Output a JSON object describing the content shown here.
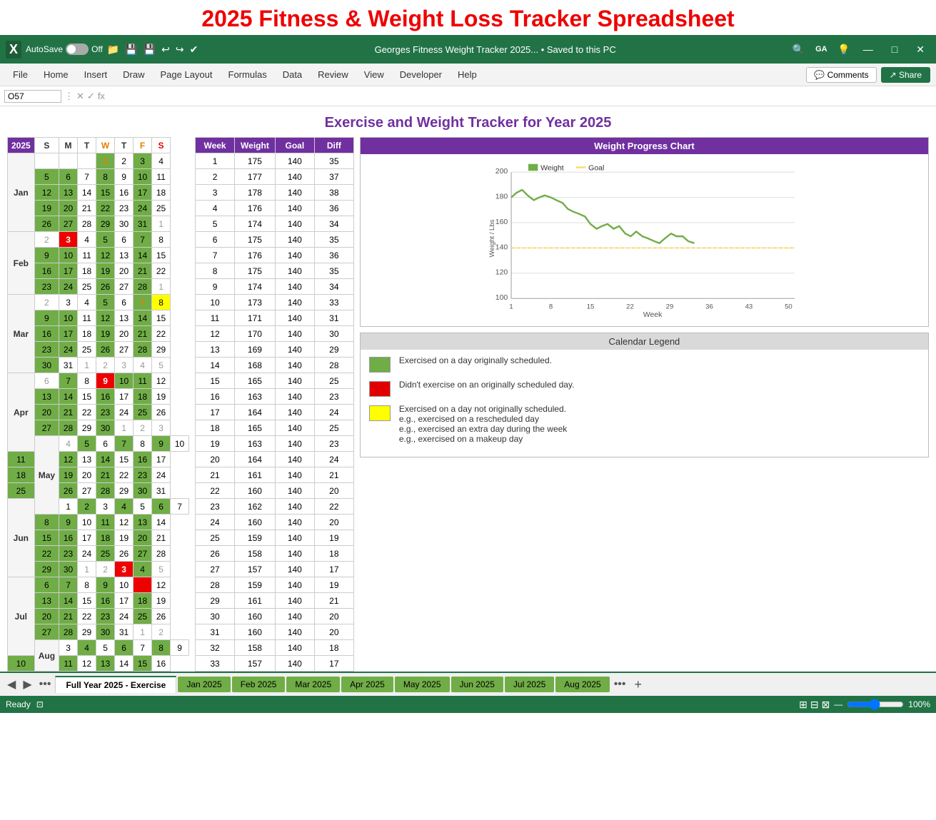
{
  "app": {
    "title": "2025 Fitness & Weight Loss Tracker Spreadsheet",
    "excel_label": "X",
    "autosave": "AutoSave",
    "autosave_state": "Off",
    "file_title": "Georges Fitness Weight Tracker 2025...  •  Saved to this PC",
    "user_initials": "GA"
  },
  "menu": {
    "items": [
      "File",
      "Home",
      "Insert",
      "Draw",
      "Page Layout",
      "Formulas",
      "Data",
      "Review",
      "View",
      "Developer",
      "Help"
    ],
    "comments": "Comments",
    "share": "Share"
  },
  "formula_bar": {
    "cell_ref": "O57",
    "formula": ""
  },
  "sheet_title": "Exercise and Weight Tracker for Year 2025",
  "calendar_headers": {
    "year": "2025",
    "days": [
      "S",
      "M",
      "T",
      "W",
      "T",
      "F",
      "S"
    ]
  },
  "week_table": {
    "headers": [
      "Week",
      "Weight",
      "Goal",
      "Diff"
    ],
    "rows": [
      [
        1,
        175,
        140,
        35
      ],
      [
        2,
        177,
        140,
        37
      ],
      [
        3,
        178,
        140,
        38
      ],
      [
        4,
        176,
        140,
        36
      ],
      [
        5,
        174,
        140,
        34
      ],
      [
        6,
        175,
        140,
        35
      ],
      [
        7,
        176,
        140,
        36
      ],
      [
        8,
        175,
        140,
        35
      ],
      [
        9,
        174,
        140,
        34
      ],
      [
        10,
        173,
        140,
        33
      ],
      [
        11,
        171,
        140,
        31
      ],
      [
        12,
        170,
        140,
        30
      ],
      [
        13,
        169,
        140,
        29
      ],
      [
        14,
        168,
        140,
        28
      ],
      [
        15,
        165,
        140,
        25
      ],
      [
        16,
        163,
        140,
        23
      ],
      [
        17,
        164,
        140,
        24
      ],
      [
        18,
        165,
        140,
        25
      ],
      [
        19,
        163,
        140,
        23
      ],
      [
        20,
        164,
        140,
        24
      ],
      [
        21,
        161,
        140,
        21
      ],
      [
        22,
        160,
        140,
        20
      ],
      [
        23,
        162,
        140,
        22
      ],
      [
        24,
        160,
        140,
        20
      ],
      [
        25,
        159,
        140,
        19
      ],
      [
        26,
        158,
        140,
        18
      ],
      [
        27,
        157,
        140,
        17
      ],
      [
        28,
        159,
        140,
        19
      ],
      [
        29,
        161,
        140,
        21
      ],
      [
        30,
        160,
        140,
        20
      ],
      [
        31,
        160,
        140,
        20
      ],
      [
        32,
        158,
        140,
        18
      ],
      [
        33,
        157,
        140,
        17
      ]
    ]
  },
  "chart": {
    "title": "Weight Progress Chart",
    "legend": [
      "Weight",
      "Goal"
    ],
    "legend_colors": [
      "#70ad47",
      "#ffd966"
    ],
    "y_labels": [
      100,
      120,
      140,
      160,
      180,
      200
    ],
    "x_labels": [
      1,
      8,
      15,
      22,
      29,
      36,
      43,
      50
    ],
    "x_axis_label": "Week",
    "y_axis_label": "Weight / Lbs"
  },
  "legend": {
    "title": "Calendar Legend",
    "items": [
      {
        "color": "#70ad47",
        "text": "Exercised on a day originally scheduled."
      },
      {
        "color": "#e00000",
        "text": "Didn't exercise on an originally scheduled day."
      },
      {
        "color": "#ffff00",
        "text": "Exercised on a day not originally scheduled.\ne.g., exercised on a rescheduled day\ne.g., exercised an extra day during the week\ne.g., exercised on a makeup day"
      }
    ]
  },
  "tabs": {
    "active": "Full Year 2025 - Exercise",
    "other": [
      "Jan 2025",
      "Feb 2025",
      "Mar 2025",
      "Apr 2025",
      "May 2025",
      "Jun 2025",
      "Jul 2025",
      "Aug 2025"
    ]
  },
  "status": {
    "ready": "Ready",
    "zoom": "100%"
  }
}
